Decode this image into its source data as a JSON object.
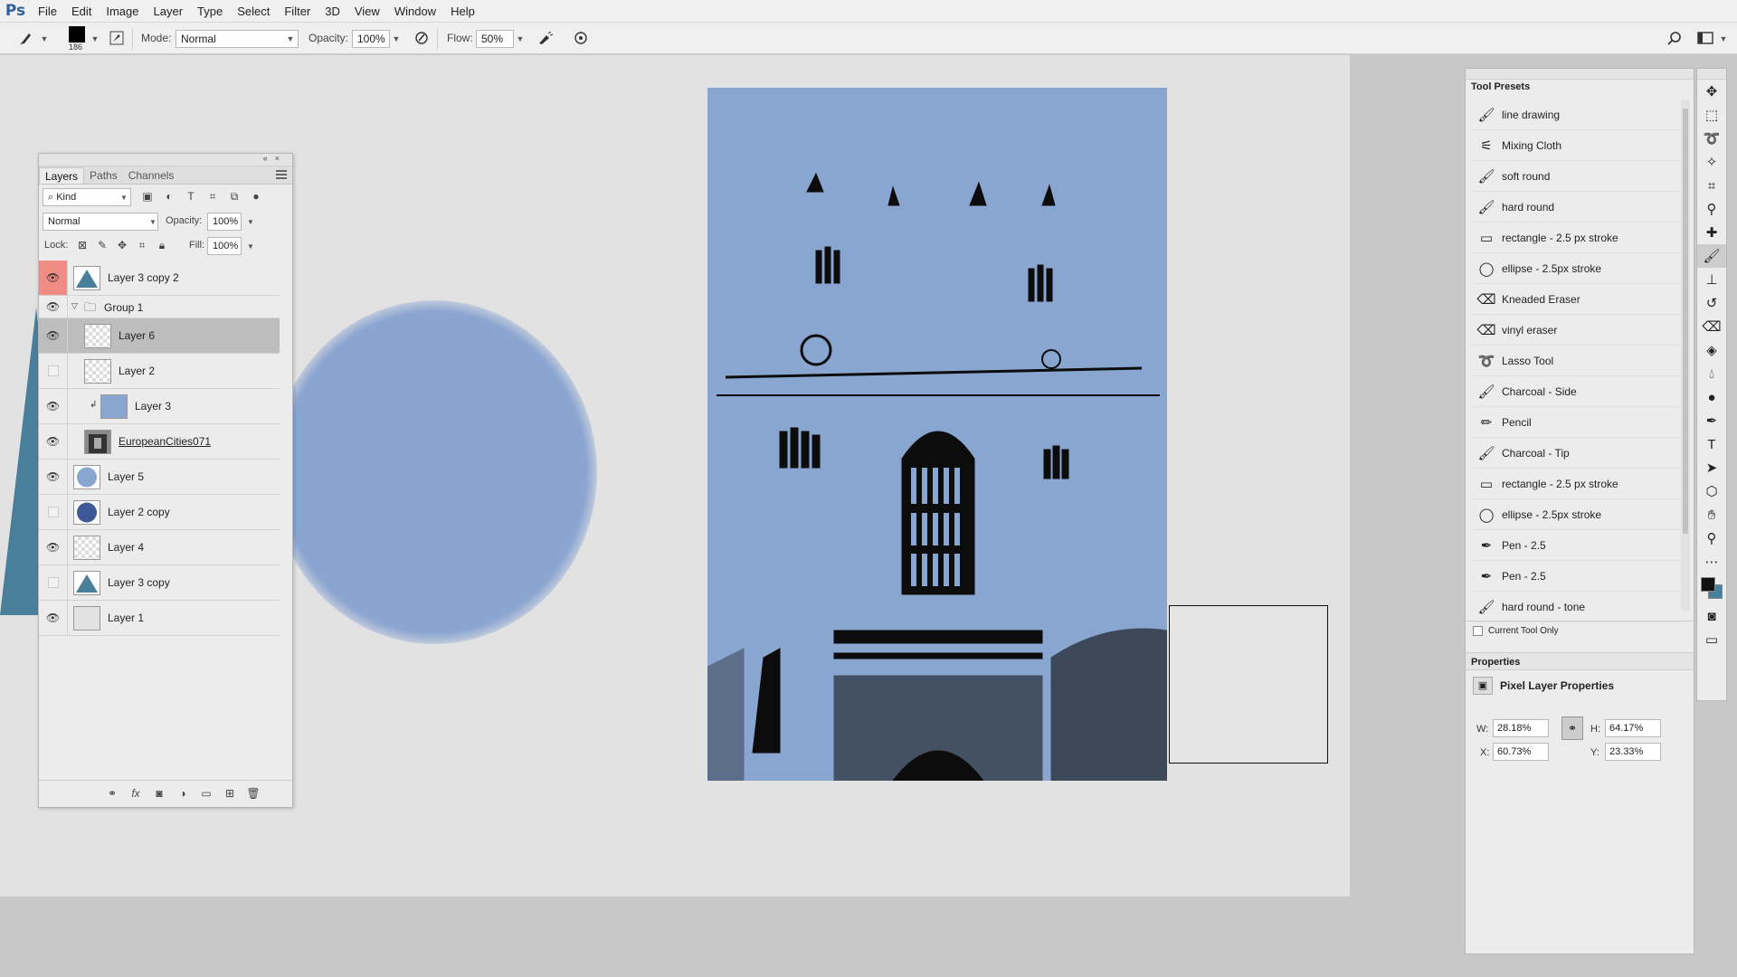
{
  "app": {
    "logo": "Ps",
    "menu": [
      "File",
      "Edit",
      "Image",
      "Layer",
      "Type",
      "Select",
      "Filter",
      "3D",
      "View",
      "Window",
      "Help"
    ]
  },
  "options_bar": {
    "brush_size": "186",
    "mode_label": "Mode:",
    "mode_value": "Normal",
    "opacity_label": "Opacity:",
    "opacity_value": "100%",
    "flow_label": "Flow:",
    "flow_value": "50%",
    "icons": [
      "brush-tool-icon",
      "brush-preset-icon",
      "pressure-opacity-icon",
      "airbrush-icon",
      "pressure-size-icon",
      "search-icon",
      "workspace-icon"
    ]
  },
  "layers_panel": {
    "tabs": [
      "Layers",
      "Paths",
      "Channels"
    ],
    "filter_kind": "Kind",
    "blend_mode": "Normal",
    "opacity_label": "Opacity:",
    "opacity_value": "100%",
    "lock_label": "Lock:",
    "fill_label": "Fill:",
    "fill_value": "100%",
    "layers": [
      {
        "name": "Layer 3 copy 2",
        "visible": true,
        "highlight": "#f08c84",
        "thumb": "triangle"
      },
      {
        "name": "Group 1",
        "visible": true,
        "type": "group"
      },
      {
        "name": "Layer 6",
        "visible": true,
        "selected": true,
        "thumb": "checker"
      },
      {
        "name": "Layer 2",
        "visible": false,
        "thumb": "checker"
      },
      {
        "name": "Layer 3",
        "visible": true,
        "clipped": true,
        "thumb": "blue-rect"
      },
      {
        "name": "EuropeanCities071",
        "visible": true,
        "thumb": "photo",
        "underline": true
      },
      {
        "name": "Layer 5",
        "visible": true,
        "thumb": "circle-light"
      },
      {
        "name": "Layer 2 copy",
        "visible": false,
        "thumb": "circle-dark"
      },
      {
        "name": "Layer 4",
        "visible": true,
        "thumb": "checker"
      },
      {
        "name": "Layer 3 copy",
        "visible": false,
        "thumb": "triangle"
      },
      {
        "name": "Layer 1",
        "visible": true,
        "thumb": "white"
      }
    ],
    "footer_icons": [
      "link-icon",
      "fx-icon",
      "mask-icon",
      "adjustment-icon",
      "folder-icon",
      "new-layer-icon",
      "trash-icon"
    ]
  },
  "tool_presets": {
    "title": "Tool Presets",
    "items": [
      {
        "label": "line drawing",
        "icon": "brush-icon"
      },
      {
        "label": "Mixing Cloth",
        "icon": "mixer-brush-icon"
      },
      {
        "label": "soft round",
        "icon": "brush-icon"
      },
      {
        "label": "hard round",
        "icon": "brush-icon"
      },
      {
        "label": "rectangle - 2.5 px stroke",
        "icon": "rectangle-icon"
      },
      {
        "label": "ellipse - 2.5px stroke",
        "icon": "ellipse-icon"
      },
      {
        "label": "Kneaded Eraser",
        "icon": "eraser-icon"
      },
      {
        "label": "vinyl eraser",
        "icon": "eraser-icon"
      },
      {
        "label": "Lasso Tool",
        "icon": "lasso-icon"
      },
      {
        "label": "Charcoal - Side",
        "icon": "brush-icon"
      },
      {
        "label": "Pencil",
        "icon": "pencil-icon"
      },
      {
        "label": "Charcoal - Tip",
        "icon": "brush-icon"
      },
      {
        "label": "rectangle - 2.5 px stroke",
        "icon": "rectangle-icon"
      },
      {
        "label": "ellipse - 2.5px stroke",
        "icon": "ellipse-icon"
      },
      {
        "label": "Pen - 2.5",
        "icon": "pen-icon"
      },
      {
        "label": "Pen - 2.5",
        "icon": "pen-icon"
      },
      {
        "label": "hard round - tone",
        "icon": "brush-icon"
      }
    ],
    "current_tool_only": "Current Tool Only"
  },
  "properties": {
    "title": "Properties",
    "subtitle": "Pixel Layer Properties",
    "w_label": "W:",
    "w_value": "28.18%",
    "h_label": "H:",
    "h_value": "64.17%",
    "x_label": "X:",
    "x_value": "60.73%",
    "y_label": "Y:",
    "y_value": "23.33%"
  },
  "toolbar": {
    "tools": [
      "move-tool-icon",
      "marquee-tool-icon",
      "lasso-tool-icon",
      "magic-wand-tool-icon",
      "crop-tool-icon",
      "eyedropper-tool-icon",
      "healing-tool-icon",
      "brush-tool-icon",
      "stamp-tool-icon",
      "history-brush-tool-icon",
      "eraser-tool-icon",
      "bucket-tool-icon",
      "blur-tool-icon",
      "dodge-tool-icon",
      "pen-tool-icon",
      "type-tool-icon",
      "path-select-tool-icon",
      "shape-tool-icon",
      "hand-tool-icon",
      "zoom-tool-icon",
      "more-tools-icon"
    ],
    "active_tool": "brush-tool-icon"
  },
  "colors": {
    "foreground": "#111111",
    "background": "#4a7f9c",
    "canvas_blue": "#88a6cf",
    "layer_highlight": "#f08c84"
  }
}
